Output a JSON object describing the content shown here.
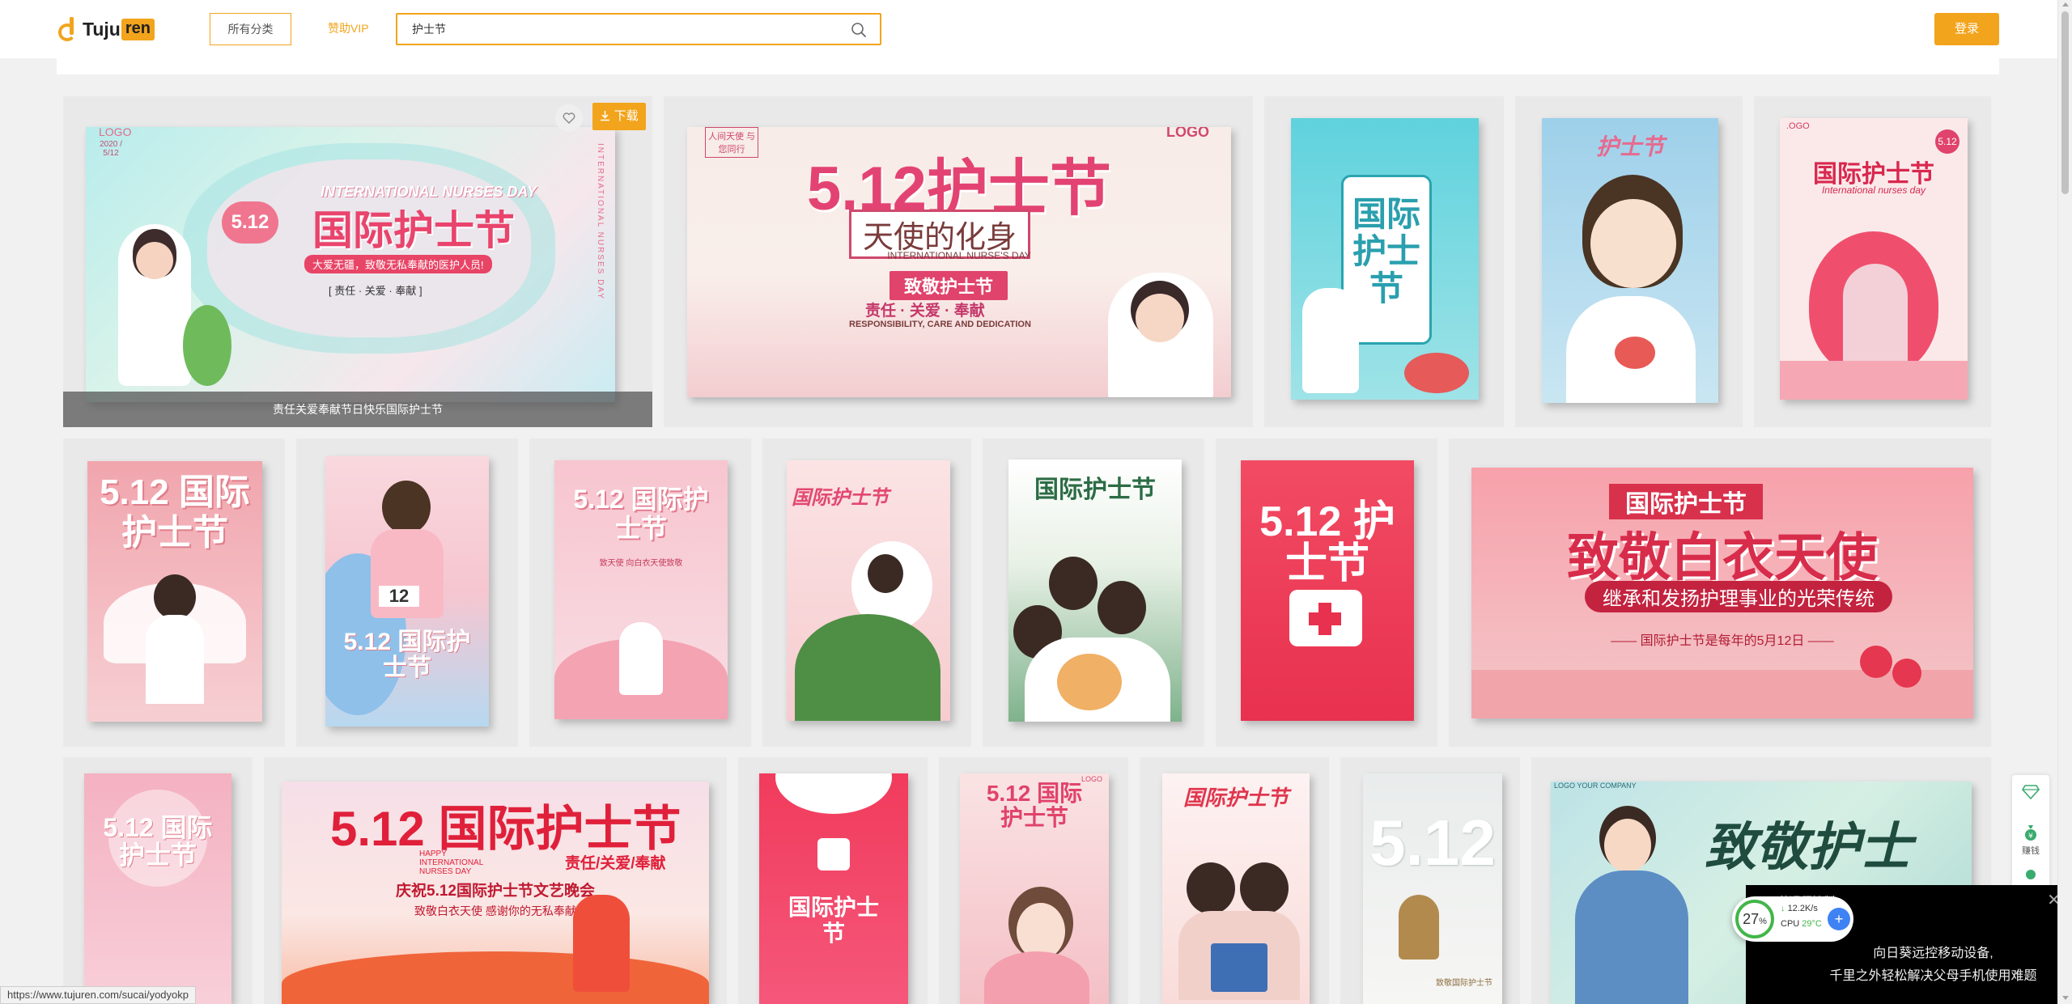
{
  "header": {
    "logo_text": "Tuju",
    "logo_badge": "ren",
    "category_button": "所有分类",
    "vip_link": "赞助VIP",
    "search_value": "护士节",
    "login_button": "登录"
  },
  "card_actions": {
    "hover_title": "责任关爱奉献节日快乐国际护士节",
    "download_label": "下载"
  },
  "cards": [
    {
      "title": "国际护士节",
      "subtitle": "INTERNATIONAL NURSES DAY",
      "extra": "大爱无疆，致敬无私奉献的医护人员!",
      "badge": "5.12",
      "tags": "[ 责任 · 关爱 · 奉献 ]",
      "logo": "LOGO",
      "date": "2020 / 5/12",
      "vertical": "INTERNATIONAL NURSES DAY"
    },
    {
      "title": "5.12护士节",
      "subtitle": "天使的化身",
      "extra": "致敬护士节",
      "tags": "责任 · 关爱 · 奉献",
      "caption": "INTERNATIONAL NURSE'S DAY",
      "footer": "RESPONSIBILITY, CARE AND DEDICATION",
      "logo": "LOGO",
      "badge": "人间天使 与您同行"
    },
    {
      "title": "国际护士节"
    },
    {
      "title": "护士节"
    },
    {
      "title": "国际护士节",
      "subtitle": "International nurses day",
      "logo": ".OGO",
      "badge": "5.12"
    },
    {
      "title": "5.12 国际护士节"
    },
    {
      "title": "5.12 国际护士节",
      "badge": "12"
    },
    {
      "title": "5.12 国际护士节",
      "subtitle": "致天使 向白衣天使致敬"
    },
    {
      "title": "国际护士节"
    },
    {
      "title": "国际护士节"
    },
    {
      "title": "5.12 护士节"
    },
    {
      "title": "致敬白衣天使",
      "subtitle": "国际护士节",
      "extra": "继承和发扬护理事业的光荣传统",
      "footer": "—— 国际护士节是每年的5月12日 ——"
    },
    {
      "title": "5.12 国际护士节"
    },
    {
      "title": "5.12 国际护士节",
      "subtitle": "责任/关爱/奉献",
      "extra": "庆祝5.12国际护士节文艺晚会",
      "footer": "致敬白衣天使   感谢你的无私奉献",
      "caption": "HAPPY INTERNATIONAL NURSES DAY"
    },
    {
      "title": "国际护士节"
    },
    {
      "title": "5.12 国际护士节",
      "logo": "LOGO"
    },
    {
      "title": "国际护士节"
    },
    {
      "title": "5.12",
      "subtitle": "致敬国际护士节"
    },
    {
      "title": "致敬护士",
      "logo": "LOGO YOUR COMPANY"
    }
  ],
  "float_bar": {
    "item2": "赚钱"
  },
  "popup": {
    "title": "日葵远程控制",
    "line1": "向日葵远控移动设备,",
    "line2": "千里之外轻松解决父母手机使用难题",
    "gauge_percent": "27",
    "gauge_unit": "%",
    "speed": "12.2K/s",
    "cpu_label": "CPU",
    "cpu_temp": "29°C"
  },
  "status_url": "https://www.tujuren.com/sucai/yodyokp"
}
